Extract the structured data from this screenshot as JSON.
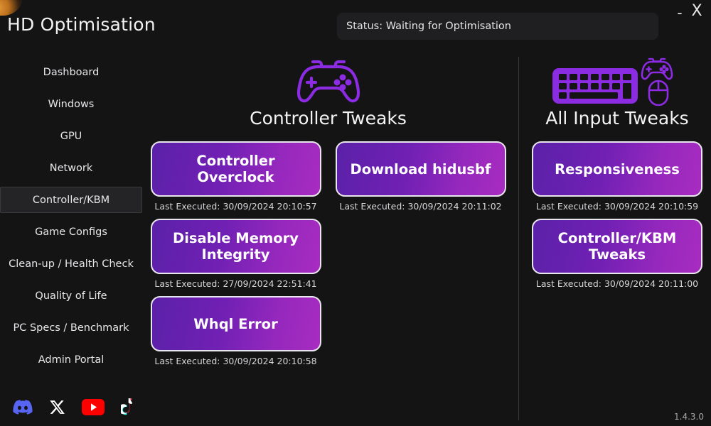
{
  "window": {
    "title": "HD Optimisation",
    "minimize_label": "-",
    "close_label": "X",
    "version": "1.4.3.0"
  },
  "status": {
    "text": "Status: Waiting for Optimisation"
  },
  "sidebar": {
    "items": [
      {
        "label": "Dashboard",
        "selected": false
      },
      {
        "label": "Windows",
        "selected": false
      },
      {
        "label": "GPU",
        "selected": false
      },
      {
        "label": "Network",
        "selected": false
      },
      {
        "label": "Controller/KBM",
        "selected": true
      },
      {
        "label": "Game Configs",
        "selected": false
      },
      {
        "label": "Clean-up / Health Check",
        "selected": false
      },
      {
        "label": "Quality of Life",
        "selected": false
      },
      {
        "label": "PC Specs / Benchmark",
        "selected": false
      },
      {
        "label": "Admin Portal",
        "selected": false
      }
    ],
    "socials": [
      {
        "name": "discord-icon",
        "label": "Discord"
      },
      {
        "name": "x-icon",
        "label": "X"
      },
      {
        "name": "youtube-icon",
        "label": "YouTube"
      },
      {
        "name": "tiktok-icon",
        "label": "TikTok"
      }
    ]
  },
  "sections": {
    "controller": {
      "title": "Controller Tweaks",
      "icon": "gamepad-icon",
      "column_a": [
        {
          "label": "Controller Overclock",
          "last_executed": "Last Executed: 30/09/2024 20:10:57"
        },
        {
          "label": "Disable Memory\nIntegrity",
          "last_executed": "Last Executed: 27/09/2024 22:51:41"
        },
        {
          "label": "Whql Error",
          "last_executed": "Last Executed: 30/09/2024 20:10:58"
        }
      ],
      "column_b": [
        {
          "label": "Download hidusbf",
          "last_executed": "Last Executed: 30/09/2024 20:11:02"
        }
      ]
    },
    "input": {
      "title": "All Input Tweaks",
      "icon": "keyboard-mouse-icon",
      "buttons": [
        {
          "label": "Responsiveness",
          "last_executed": "Last Executed: 30/09/2024 20:10:59"
        },
        {
          "label": "Controller/KBM\nTweaks",
          "last_executed": "Last Executed: 30/09/2024 20:11:00"
        }
      ]
    }
  },
  "colors": {
    "background": "#141415",
    "accent_gradient_start": "#5b21a8",
    "accent_gradient_end": "#a82cc0",
    "icon_purple": "#8b2be2",
    "discord": "#5865f2",
    "youtube": "#ff0000",
    "text_primary": "#f2f2f3",
    "text_secondary": "#d6d6d8"
  }
}
